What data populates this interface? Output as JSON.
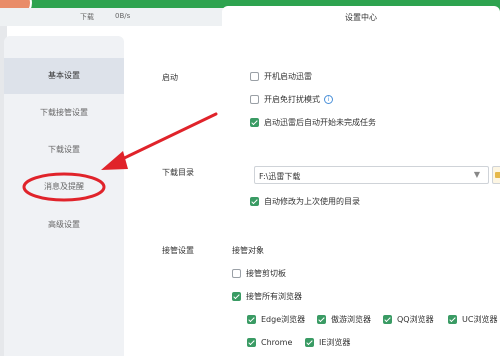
{
  "header": {
    "download_label": "下载",
    "speed": "0B/s",
    "active_tab": "设置中心"
  },
  "sidebar": {
    "items": [
      {
        "label": "基本设置",
        "active": true
      },
      {
        "label": "下载接管设置",
        "active": false
      },
      {
        "label": "下载设置",
        "active": false
      },
      {
        "label": "消息及提醒",
        "active": false
      },
      {
        "label": "高级设置",
        "active": false
      }
    ]
  },
  "startup": {
    "label": "启动",
    "options": [
      {
        "label": "开机启动迅雷",
        "checked": false
      },
      {
        "label": "开启免打扰模式",
        "checked": false
      },
      {
        "label": "启动迅雷后自动开始未完成任务",
        "checked": true
      }
    ]
  },
  "download_dir": {
    "label": "下载目录",
    "path": "F:\\迅雷下载",
    "auto_modify": {
      "label": "自动修改为上次使用的目录",
      "checked": true
    }
  },
  "takeover": {
    "label": "接管设置",
    "target_label": "接管对象",
    "clipboard": {
      "label": "接管剪切板",
      "checked": false
    },
    "all_browsers": {
      "label": "接管所有浏览器",
      "checked": true
    },
    "browsers": [
      {
        "label": "Edge浏览器",
        "checked": true
      },
      {
        "label": "傲游浏览器",
        "checked": true
      },
      {
        "label": "QQ浏览器",
        "checked": true
      },
      {
        "label": "UC浏览器",
        "checked": true
      },
      {
        "label": "Chrome",
        "checked": true
      },
      {
        "label": "IE浏览器",
        "checked": true
      }
    ]
  },
  "annotation": {
    "color": "#e0232a"
  },
  "theme": {
    "accent": "#2ea34f",
    "checkbox": "#3a9b64"
  }
}
